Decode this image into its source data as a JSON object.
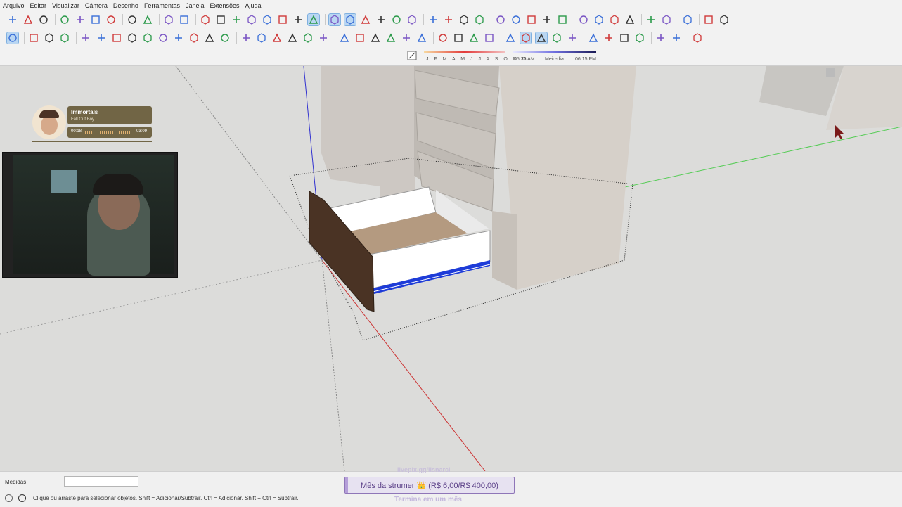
{
  "menu": [
    "Arquivo",
    "Editar",
    "Visualizar",
    "Câmera",
    "Desenho",
    "Ferramentas",
    "Janela",
    "Extensões",
    "Ajuda"
  ],
  "shadow": {
    "months": "J F M A M J J A S O N D",
    "time_start": "05:36 AM",
    "time_mid": "Meio-dia",
    "time_end": "06:15 PM"
  },
  "music": {
    "title": "Immortals",
    "artist": "Fall Out Boy",
    "elapsed": "00:18",
    "duration": "03:09"
  },
  "status": {
    "measures_label": "Medidas",
    "measures_value": "",
    "hint": "Clique ou arraste para selecionar objetos. Shift = Adicionar/Subtrair. Ctrl = Adicionar. Shift + Ctrl = Subtrair."
  },
  "overlay": {
    "link": "livepix.gg/lisnarcl",
    "goal": "Mês da strumer 👑 (R$ 6,00/R$ 400,00)",
    "sub": "Termina em um mês",
    "goal_progress": 0.015
  },
  "colors": {
    "accent": "#1e3cd8",
    "wood": "#4a3324",
    "selection": "#b9d6f2"
  },
  "icons": {
    "row1": [
      "new-file-icon",
      "open-folder-icon",
      "save-icon",
      "cut-icon",
      "copy-icon",
      "paste-icon",
      "erase-icon",
      "undo-icon",
      "redo-icon",
      "print-icon",
      "model-info-icon",
      "iso-view-icon",
      "top-view-icon",
      "front-view-icon",
      "right-view-icon",
      "back-view-icon",
      "left-view-icon",
      "bottom-view-icon",
      "xray-icon",
      "back-edges-icon",
      "wireframe-icon",
      "hidden-line-icon",
      "shaded-icon",
      "textured-icon",
      "monochrome-icon",
      "section-plane-icon",
      "section-cuts-icon",
      "section-fill-icon",
      "display-sections-icon",
      "3d-warehouse-icon",
      "share-model-icon",
      "extension-warehouse-icon",
      "layout-icon",
      "extension-manager-icon",
      "add-location-icon",
      "toggle-terrain-icon",
      "geo-icon",
      "photo-icon",
      "generate-report-icon",
      "classifier-icon",
      "info-icon",
      "cart-icon",
      "account-icon"
    ],
    "row2": [
      "select-icon",
      "make-component-icon",
      "paint-bucket-icon",
      "eraser-icon",
      "line-icon",
      "freehand-icon",
      "rectangle-icon",
      "rotated-rectangle-icon",
      "circle-icon",
      "polygon-icon",
      "arc-icon",
      "two-point-arc-icon",
      "three-point-arc-icon",
      "pie-icon",
      "move-icon",
      "push-pull-icon",
      "rotate-icon",
      "scale-icon",
      "offset-icon",
      "follow-me-icon",
      "tape-measure-icon",
      "dimension-icon",
      "protractor-icon",
      "text-icon",
      "axes-icon",
      "3d-text-icon",
      "orbit-icon",
      "pan-icon",
      "zoom-icon",
      "zoom-window-icon",
      "zoom-extents-icon",
      "previous-view-icon",
      "position-camera-icon",
      "look-around-icon",
      "walk-icon",
      "sandbox-icon",
      "iso-box-icon",
      "component-box-icon",
      "mirror-icon",
      "bend-icon",
      "tag-icon",
      "outliner-icon"
    ]
  }
}
